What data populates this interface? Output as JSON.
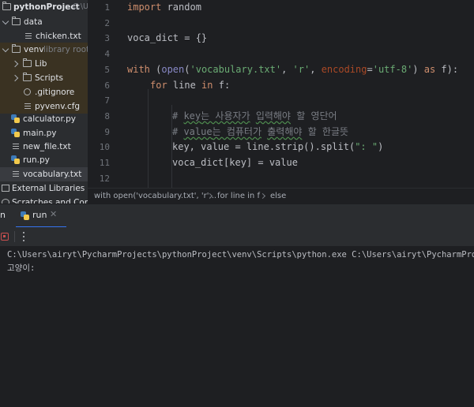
{
  "project_tree": {
    "root_name": "pythonProject",
    "root_path": "C:\\U",
    "items": [
      {
        "label": "data"
      },
      {
        "label": "chicken.txt"
      },
      {
        "label": "venv",
        "note": "library root"
      },
      {
        "label": "Lib"
      },
      {
        "label": "Scripts"
      },
      {
        "label": ".gitignore"
      },
      {
        "label": "pyvenv.cfg"
      },
      {
        "label": "calculator.py"
      },
      {
        "label": "main.py"
      },
      {
        "label": "new_file.txt"
      },
      {
        "label": "run.py"
      },
      {
        "label": "vocabulary.txt"
      },
      {
        "label": "External Libraries"
      },
      {
        "label": "Scratches and Consoles"
      }
    ]
  },
  "editor": {
    "line_numbers": [
      "1",
      "2",
      "3",
      "4",
      "5",
      "6",
      "7",
      "8",
      "9",
      "10",
      "11",
      "12"
    ],
    "code": {
      "l1_kw": "import",
      "l1_rest": " random",
      "l3": "voca_dict = {}",
      "l5_with": "with",
      "l5_p1": " (",
      "l5_open": "open",
      "l5_p2": "(",
      "l5_s1": "'vocabulary.txt'",
      "l5_c1": ", ",
      "l5_s2": "'r'",
      "l5_c2": ", ",
      "l5_enc": "encoding",
      "l5_eq": "=",
      "l5_s3": "'utf-8'",
      "l5_p3": ") ",
      "l5_as": "as",
      "l5_end": " f):",
      "l6_for": "for",
      "l6_mid": " line ",
      "l6_in": "in",
      "l6_end": " f:",
      "l8_hash": "# ",
      "l8_key": "key",
      "l8_word1": "는 사용자가",
      "l8_sp": " ",
      "l8_word2": "입력해야",
      "l8_rest": " 할 영단어",
      "l9_hash": "# ",
      "l9_value": "value",
      "l9_word1": "는 컴퓨터가",
      "l9_sp": " ",
      "l9_word2": "출력해야",
      "l9_rest": " 할 한글뜻",
      "l10_a": "key, value = line.strip().split(",
      "l10_s": "\": \"",
      "l10_b": ")",
      "l11": "voca_dict[key] = value"
    }
  },
  "breadcrumbs": [
    "with open('vocabulary.txt', 'r'...",
    "for line in f",
    "else"
  ],
  "run_panel": {
    "left_tab_fragment": "n",
    "tab_label": "run",
    "console_lines": [
      "C:\\Users\\airyt\\PycharmProjects\\pythonProject\\venv\\Scripts\\python.exe C:\\Users\\airyt\\PycharmProjects\\p",
      "고양이:"
    ]
  },
  "colors": {
    "keyword": "#cf8e6d",
    "builtin": "#8888c6",
    "string": "#6aab73",
    "comment": "#7a7e85",
    "stop_button": "#c94f4f"
  },
  "icons": [
    "chevron-down-icon",
    "chevron-right-icon",
    "folder-icon",
    "text-file-icon",
    "python-file-icon",
    "stop-icon",
    "more-options-icon",
    "close-icon"
  ]
}
